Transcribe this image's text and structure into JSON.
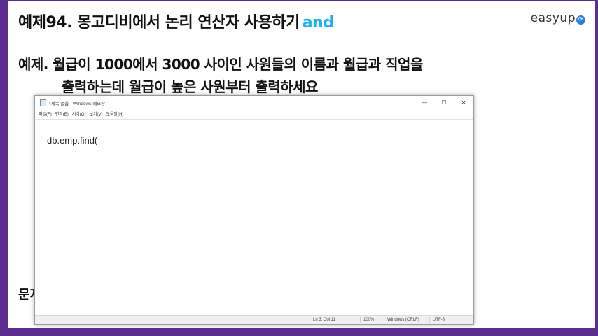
{
  "slide": {
    "title": "예제94. 몽고디비에서 논리 연산자 사용하기",
    "title_keyword": "and",
    "title_keyword_color": "#1fb0f0",
    "logo_text": "easyup",
    "problem_line1": "예제. 월급이 1000에서 3000 사이인 사원들의 이름과 월급과 직업을",
    "problem_line2": "출력하는데 월급이 높은 사원부터 출력하세요",
    "bottom_label": "문저"
  },
  "notepad": {
    "window_title": "*제목 없음 - Windows 메모장",
    "controls": {
      "minimize": "—",
      "maximize": "☐",
      "close": "✕"
    },
    "menu": [
      "파일(F)",
      "편집(E)",
      "서식(O)",
      "보기(V)",
      "도움말(H)"
    ],
    "content": "db.emp.find(",
    "status": {
      "position": "Ln 3, Col 11",
      "zoom": "100%",
      "line_ending": "Windows (CRLF)",
      "encoding": "UTF-8"
    }
  },
  "colors": {
    "background": "#5b2d8e",
    "slide": "#ffffff"
  }
}
